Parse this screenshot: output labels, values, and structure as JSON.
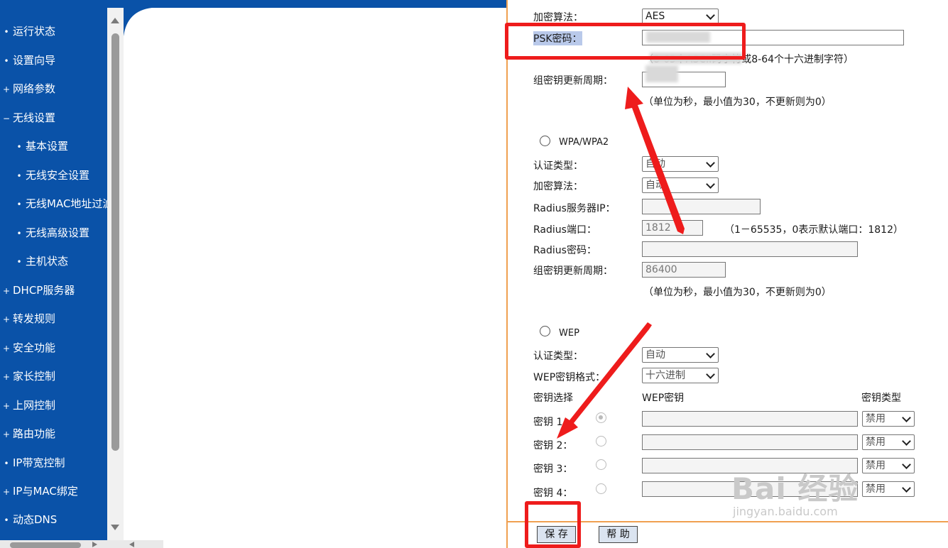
{
  "sidebar": {
    "items": [
      {
        "marker": "•",
        "label": "运行状态"
      },
      {
        "marker": "•",
        "label": "设置向导"
      },
      {
        "marker": "+",
        "label": "网络参数"
      },
      {
        "marker": "−",
        "label": "无线设置"
      },
      {
        "marker": "•",
        "label": "基本设置"
      },
      {
        "marker": "•",
        "label": "无线安全设置"
      },
      {
        "marker": "•",
        "label": "无线MAC地址过滤"
      },
      {
        "marker": "•",
        "label": "无线高级设置"
      },
      {
        "marker": "•",
        "label": "主机状态"
      },
      {
        "marker": "+",
        "label": "DHCP服务器"
      },
      {
        "marker": "+",
        "label": "转发规则"
      },
      {
        "marker": "+",
        "label": "安全功能"
      },
      {
        "marker": "+",
        "label": "家长控制"
      },
      {
        "marker": "+",
        "label": "上网控制"
      },
      {
        "marker": "+",
        "label": "路由功能"
      },
      {
        "marker": "•",
        "label": "IP带宽控制"
      },
      {
        "marker": "+",
        "label": "IP与MAC绑定"
      },
      {
        "marker": "•",
        "label": "动态DNS"
      }
    ]
  },
  "wpa_psk": {
    "cipher_label": "加密算法：",
    "cipher_value": "AES",
    "psk_label": "PSK密码：",
    "psk_hint": "（8-63个ASCII码字符或8-64个十六进制字符）",
    "group_key_label": "组密钥更新周期：",
    "group_key_hint": "（单位为秒，最小值为30，不更新则为0）"
  },
  "wpa": {
    "title": "WPA/WPA2",
    "auth_label": "认证类型：",
    "auth_value": "自动",
    "cipher_label": "加密算法：",
    "cipher_value": "自动",
    "radius_ip_label": "Radius服务器IP：",
    "radius_ip_value": "",
    "radius_port_label": "Radius端口：",
    "radius_port_value": "1812",
    "radius_port_hint": "（1－65535，0表示默认端口：1812）",
    "radius_pwd_label": "Radius密码：",
    "group_key_label": "组密钥更新周期：",
    "group_key_value": "86400",
    "group_key_hint": "（单位为秒，最小值为30，不更新则为0）"
  },
  "wep": {
    "title": "WEP",
    "auth_label": "认证类型：",
    "auth_value": "自动",
    "format_label": "WEP密钥格式：",
    "format_value": "十六进制",
    "col_key_select": "密钥选择",
    "col_wep_key": "WEP密钥",
    "col_key_type": "密钥类型",
    "keys": [
      {
        "label": "密钥 1：",
        "type": "禁用"
      },
      {
        "label": "密钥 2：",
        "type": "禁用"
      },
      {
        "label": "密钥 3：",
        "type": "禁用"
      },
      {
        "label": "密钥 4：",
        "type": "禁用"
      }
    ]
  },
  "buttons": {
    "save": "保 存",
    "help": "帮 助"
  },
  "watermark": {
    "brand": "Bai 经验",
    "url": "jingyan.baidu.com"
  },
  "colors": {
    "sidebar": "#0a52a8",
    "panel_border": "#f0a050",
    "annotation": "#ee1c1c"
  }
}
